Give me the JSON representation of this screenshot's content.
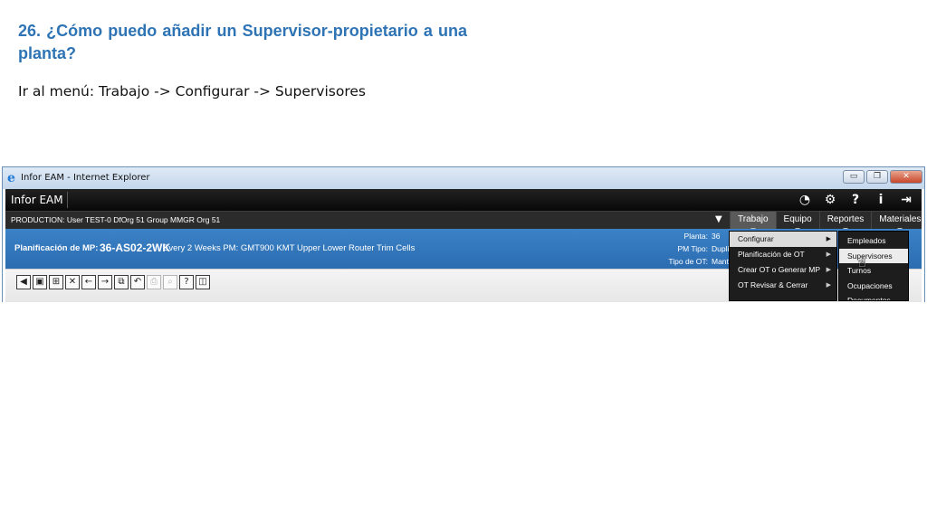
{
  "slide": {
    "title": "26. ¿Cómo puedo añadir un Supervisor-propietario a una planta?",
    "instruction": "Ir al menú: Trabajo -> Configurar -> Supervisores"
  },
  "window": {
    "title": "Infor EAM - Internet Explorer",
    "buttons": {
      "minimize": "▭",
      "restore": "❐",
      "close": "✕"
    }
  },
  "app": {
    "name": "Infor EAM",
    "icons": [
      "dashboard-gauge-icon",
      "gear-icon",
      "help-icon",
      "info-icon",
      "logout-icon"
    ],
    "icon_glyphs": [
      "◔",
      "⚙",
      "?",
      "i",
      "⇥"
    ]
  },
  "infobar": {
    "text": "PRODUCTION: User TEST-0 DfOrg 51 Group MMGR Org 51",
    "caret": "▼",
    "menus": [
      "Trabajo",
      "Equipo",
      "Reportes",
      "Materiales"
    ],
    "active_menu": "Trabajo"
  },
  "header": {
    "label": "Planificación de MP:",
    "code": "36-AS02-2WK",
    "description": "Every 2 Weeks PM: GMT900 KMT Upper Lower Router Trim Cells",
    "fields": [
      {
        "label": "Planta:",
        "value": "36"
      },
      {
        "label": "PM Tipo:",
        "value": "Duplic"
      },
      {
        "label": "Tipo de OT:",
        "value": "Mant."
      }
    ]
  },
  "toolbar": {
    "tools": [
      {
        "name": "first-record-icon",
        "glyph": "◀",
        "enabled": true
      },
      {
        "name": "save-icon",
        "glyph": "▣",
        "enabled": true
      },
      {
        "name": "new-record-icon",
        "glyph": "⊞",
        "enabled": true
      },
      {
        "name": "delete-icon",
        "glyph": "✕",
        "enabled": true
      },
      {
        "name": "previous-arrow-icon",
        "glyph": "←",
        "enabled": true
      },
      {
        "name": "next-arrow-icon",
        "glyph": "→",
        "enabled": true
      },
      {
        "name": "copy-icon",
        "glyph": "⧉",
        "enabled": true
      },
      {
        "name": "undo-icon",
        "glyph": "↶",
        "enabled": true
      },
      {
        "name": "print-icon",
        "glyph": "⎙",
        "enabled": false
      },
      {
        "name": "preview-icon",
        "glyph": "⌕",
        "enabled": false
      },
      {
        "name": "help-icon",
        "glyph": "?",
        "enabled": true
      },
      {
        "name": "book-icon",
        "glyph": "◫",
        "enabled": true
      }
    ]
  },
  "dropdown": {
    "items": [
      {
        "label": "Configurar",
        "has_submenu": true,
        "highlighted": true
      },
      {
        "label": "Planificación de OT",
        "has_submenu": true,
        "highlighted": false
      },
      {
        "label": "Crear OT o Generar MP",
        "has_submenu": true,
        "highlighted": false
      },
      {
        "label": "OT Revisar & Cerrar",
        "has_submenu": true,
        "highlighted": false
      }
    ],
    "arrow": "▶"
  },
  "submenu": {
    "items": [
      {
        "label": "Empleados",
        "highlighted": false
      },
      {
        "label": "Supervisores",
        "highlighted": true
      },
      {
        "label": "Turnos",
        "highlighted": false
      },
      {
        "label": "Ocupaciones",
        "highlighted": false
      },
      {
        "label": "Documentos",
        "highlighted": false
      }
    ]
  },
  "cursor": {
    "glyph": "☝"
  }
}
